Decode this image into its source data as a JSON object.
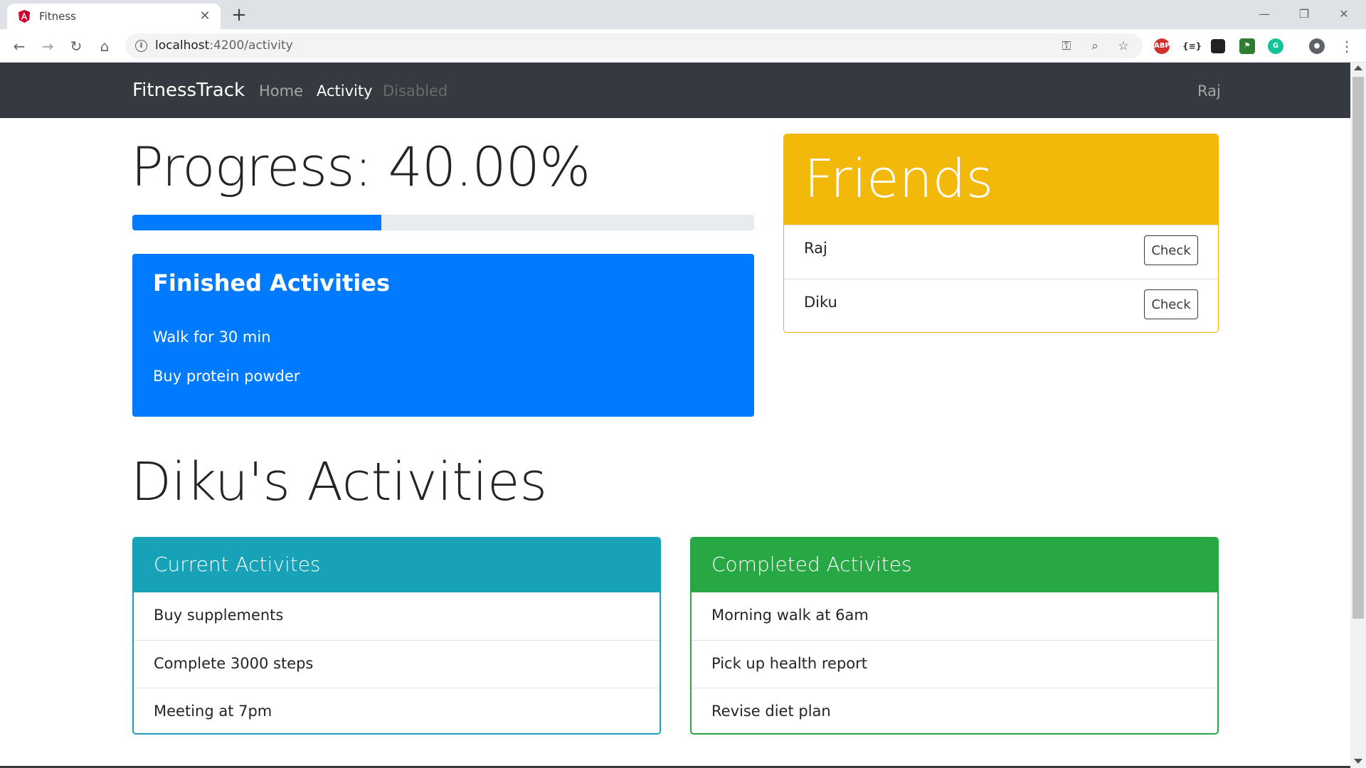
{
  "browser": {
    "tab_title": "Fitness",
    "url_host": "localhost",
    "url_path": ":4200/activity"
  },
  "navbar": {
    "brand": "FitnessTrack",
    "links": [
      {
        "label": "Home",
        "state": "normal"
      },
      {
        "label": "Activity",
        "state": "active"
      },
      {
        "label": "Disabled",
        "state": "disabled"
      }
    ],
    "user": "Raj"
  },
  "progress": {
    "title": "Progress: 40.00%",
    "value_percent": 40
  },
  "finished_activities": {
    "title": "Finished Activities",
    "items": [
      "Walk for 30 min",
      "Buy protein powder"
    ]
  },
  "friends": {
    "title": "Friends",
    "items": [
      {
        "name": "Raj",
        "button": "Check"
      },
      {
        "name": "Diku",
        "button": "Check"
      }
    ]
  },
  "diku_section": {
    "title": "Diku's Activities",
    "current": {
      "title": "Current Activites",
      "items": [
        "Buy supplements",
        "Complete 3000 steps",
        "Meeting at 7pm"
      ]
    },
    "completed": {
      "title": "Completed Activites",
      "items": [
        "Morning walk at 6am",
        "Pick up health report",
        "Revise diet plan"
      ]
    }
  },
  "colors": {
    "navbar": "#343a40",
    "primary": "#007bff",
    "warning": "#f3b90a",
    "info": "#17a2b8",
    "success": "#28a745"
  }
}
